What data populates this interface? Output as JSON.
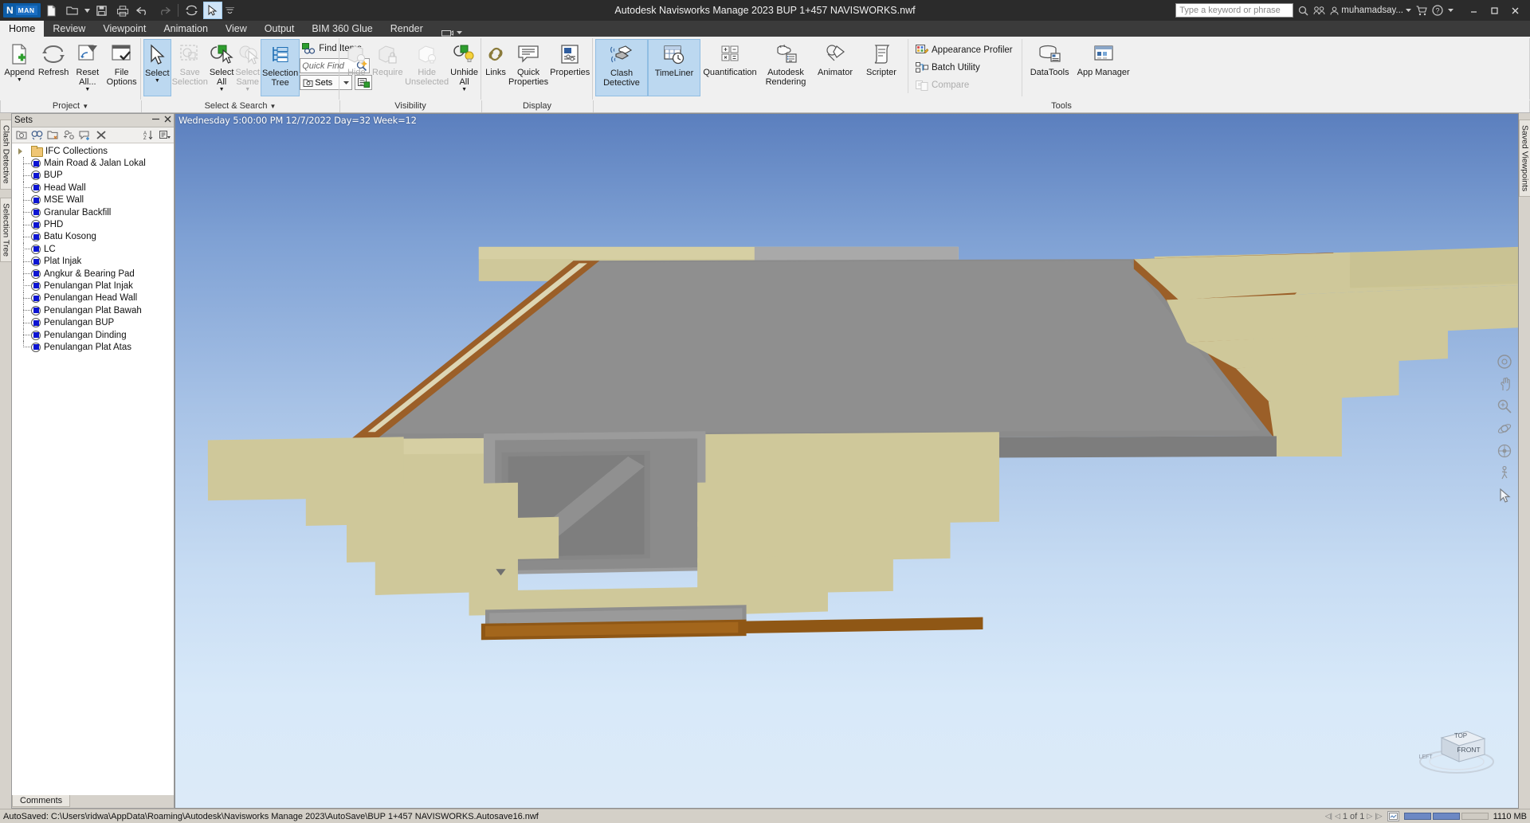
{
  "titlebar": {
    "app_badge": "N",
    "app_badge_sub": "MAN",
    "title": "Autodesk Navisworks Manage 2023    BUP 1+457 NAVISWORKS.nwf",
    "search_placeholder": "Type a keyword or phrase",
    "user": "muhamadsay...",
    "qat": [
      "new-icon",
      "open-icon",
      "save-icon",
      "print-icon",
      "undo-icon",
      "redo-icon",
      "refresh-icon",
      "select-icon",
      "customize-icon"
    ],
    "window_buttons": [
      "minimize",
      "maximize",
      "close"
    ]
  },
  "tabs": [
    {
      "label": "Home",
      "active": true
    },
    {
      "label": "Review",
      "active": false
    },
    {
      "label": "Viewpoint",
      "active": false
    },
    {
      "label": "Animation",
      "active": false
    },
    {
      "label": "View",
      "active": false
    },
    {
      "label": "Output",
      "active": false
    },
    {
      "label": "BIM 360 Glue",
      "active": false
    },
    {
      "label": "Render",
      "active": false
    }
  ],
  "ribbon": {
    "panels": [
      {
        "title": "Project",
        "buttons": [
          {
            "label": "Append",
            "icon": "append-icon",
            "dropdown": true,
            "disabled": false,
            "active": false
          },
          {
            "label": "Refresh",
            "icon": "refresh-icon",
            "dropdown": false,
            "disabled": false,
            "active": false
          },
          {
            "label": "Reset All...",
            "icon": "reset-all-icon",
            "dropdown": true,
            "disabled": false,
            "active": false
          },
          {
            "label": "File Options",
            "icon": "file-options-icon",
            "dropdown": false,
            "disabled": false,
            "active": false
          }
        ]
      },
      {
        "title": "Select & Search",
        "buttons": [
          {
            "label": "Select",
            "icon": "select-arrow-icon",
            "dropdown": true,
            "disabled": false,
            "active": true
          },
          {
            "label": "Save Selection",
            "icon": "save-selection-icon",
            "dropdown": false,
            "disabled": true,
            "active": false
          },
          {
            "label": "Select All",
            "icon": "select-all-icon",
            "dropdown": true,
            "disabled": false,
            "active": false
          },
          {
            "label": "Select Same",
            "icon": "select-same-icon",
            "dropdown": true,
            "disabled": true,
            "active": false
          },
          {
            "label": "Selection Tree",
            "icon": "selection-tree-icon",
            "dropdown": false,
            "disabled": false,
            "active": true
          }
        ],
        "find_items_label": "Find Items",
        "quick_find_placeholder": "Quick Find",
        "sets_label": "Sets"
      },
      {
        "title": "Visibility",
        "buttons": [
          {
            "label": "Hide",
            "icon": "hide-icon",
            "dropdown": false,
            "disabled": true,
            "active": false
          },
          {
            "label": "Require",
            "icon": "require-icon",
            "dropdown": false,
            "disabled": true,
            "active": false
          },
          {
            "label": "Hide Unselected",
            "icon": "hide-unselected-icon",
            "dropdown": false,
            "disabled": true,
            "active": false
          },
          {
            "label": "Unhide All",
            "icon": "unhide-all-icon",
            "dropdown": true,
            "disabled": false,
            "active": false
          }
        ]
      },
      {
        "title": "Display",
        "buttons": [
          {
            "label": "Links",
            "icon": "links-icon",
            "dropdown": false,
            "disabled": false,
            "active": false
          },
          {
            "label": "Quick Properties",
            "icon": "quick-properties-icon",
            "dropdown": false,
            "disabled": false,
            "active": false
          },
          {
            "label": "Properties",
            "icon": "properties-icon",
            "dropdown": false,
            "disabled": false,
            "active": false
          }
        ]
      },
      {
        "title": "Tools",
        "buttons": [
          {
            "label": "Clash Detective",
            "icon": "clash-detective-icon",
            "dropdown": false,
            "disabled": false,
            "active": true
          },
          {
            "label": "TimeLiner",
            "icon": "timeliner-icon",
            "dropdown": false,
            "disabled": false,
            "active": true
          },
          {
            "label": "Quantification",
            "icon": "quantification-icon",
            "dropdown": false,
            "disabled": false,
            "active": false
          },
          {
            "label": "Autodesk Rendering",
            "icon": "autodesk-rendering-icon",
            "dropdown": false,
            "disabled": false,
            "active": false
          },
          {
            "label": "Animator",
            "icon": "animator-icon",
            "dropdown": false,
            "disabled": false,
            "active": false
          },
          {
            "label": "Scripter",
            "icon": "scripter-icon",
            "dropdown": false,
            "disabled": false,
            "active": false
          }
        ],
        "small_buttons": [
          {
            "label": "Appearance Profiler",
            "icon": "appearance-profiler-icon",
            "disabled": false
          },
          {
            "label": "Batch Utility",
            "icon": "batch-utility-icon",
            "disabled": false
          },
          {
            "label": "Compare",
            "icon": "compare-icon",
            "disabled": true
          }
        ],
        "trailing_buttons": [
          {
            "label": "DataTools",
            "icon": "datatools-icon",
            "disabled": false
          },
          {
            "label": "App Manager",
            "icon": "app-manager-icon",
            "disabled": false
          }
        ]
      }
    ]
  },
  "left_rail_tabs": [
    "Clash Detective",
    "Selection Tree"
  ],
  "right_rail_tabs": [
    "Saved Viewpoints"
  ],
  "sets_panel": {
    "title": "Sets",
    "header_buttons": [
      "minimize-icon",
      "close-icon"
    ],
    "toolbar_icons": [
      "new-search-set-icon",
      "find-icon",
      "new-folder-icon",
      "new-selection-set-icon",
      "add-comment-icon",
      "delete-icon",
      "sort-icon",
      "options-icon"
    ],
    "tree": [
      {
        "label": "IFC Collections",
        "type": "folder",
        "expandable": true
      },
      {
        "label": "Main Road & Jalan Lokal",
        "type": "set"
      },
      {
        "label": "BUP",
        "type": "set"
      },
      {
        "label": "Head Wall",
        "type": "set"
      },
      {
        "label": "MSE Wall",
        "type": "set"
      },
      {
        "label": "Granular Backfill",
        "type": "set"
      },
      {
        "label": "PHD",
        "type": "set"
      },
      {
        "label": "Batu Kosong",
        "type": "set"
      },
      {
        "label": "LC",
        "type": "set"
      },
      {
        "label": "Plat Injak",
        "type": "set"
      },
      {
        "label": "Angkur & Bearing Pad",
        "type": "set"
      },
      {
        "label": "Penulangan Plat Injak",
        "type": "set"
      },
      {
        "label": "Penulangan Head Wall",
        "type": "set"
      },
      {
        "label": "Penulangan Plat Bawah",
        "type": "set"
      },
      {
        "label": "Penulangan BUP",
        "type": "set"
      },
      {
        "label": "Penulangan Dinding",
        "type": "set"
      },
      {
        "label": "Penulangan Plat Atas",
        "type": "set"
      }
    ]
  },
  "viewport": {
    "timeliner_overlay": "Wednesday 5:00:00 PM 12/7/2022 Day=32 Week=12",
    "viewcube_faces": {
      "top": "TOP",
      "front": "FRONT",
      "left": "LEFT"
    },
    "nav_icons": [
      "steering-wheel-icon",
      "pan-icon",
      "zoom-icon",
      "orbit-icon",
      "look-around-icon",
      "walk-icon",
      "select-cursor-icon"
    ],
    "colors": {
      "sky_top": "#5b7fbe",
      "sky_bottom": "#dceaf8",
      "backfill_tan": "#cfc89a",
      "concrete_gray": "#8a8a8a",
      "asphalt_dark": "#6e6e6e",
      "brown_layer": "#9b5f28",
      "dark_brown": "#6b4416"
    }
  },
  "bottom_tabs": [
    {
      "label": "Comments"
    }
  ],
  "statusbar": {
    "autosave_text": "AutoSaved: C:\\Users\\ridwa\\AppData\\Roaming\\Autodesk\\Navisworks Manage 2023\\AutoSave\\BUP 1+457 NAVISWORKS.Autosave16.nwf",
    "page_indicator": "1 of 1",
    "memory": "1110 MB",
    "progress_bars": [
      "#6c88c4",
      "#6c88c4",
      "#cfcbc3"
    ]
  }
}
